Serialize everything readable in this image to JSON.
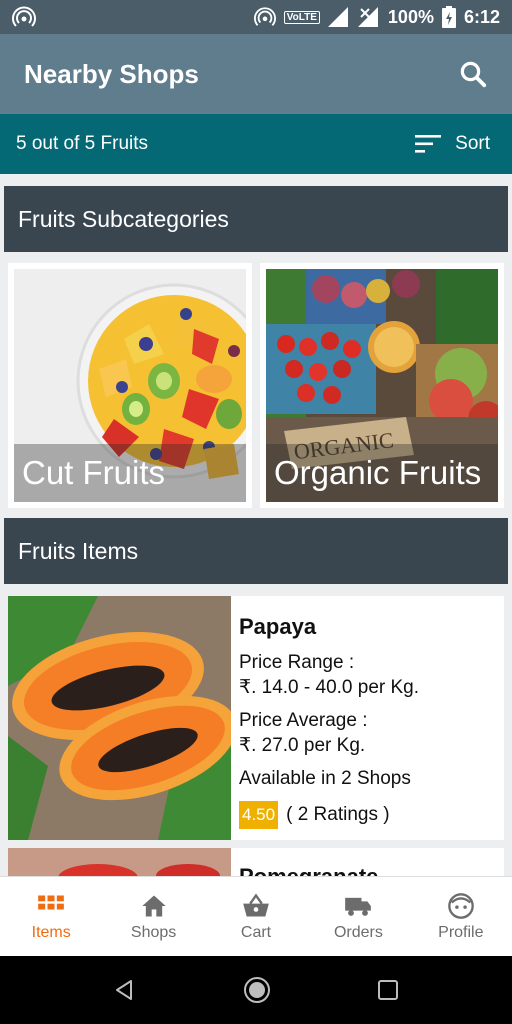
{
  "status_bar": {
    "battery": "100%",
    "time": "6:12",
    "network": "4G",
    "volte": "VoLTE"
  },
  "app_bar": {
    "title": "Nearby Shops"
  },
  "sub_bar": {
    "count_text": "5 out of 5 Fruits",
    "sort_label": "Sort"
  },
  "subcategories": {
    "header": "Fruits Subcategories",
    "items": [
      {
        "label": "Cut Fruits"
      },
      {
        "label": "Organic Fruits",
        "sign_text": "ORGANIC"
      }
    ]
  },
  "items_section": {
    "header": "Fruits Items",
    "cards": [
      {
        "name": "Papaya",
        "price_range_label": "Price Range :",
        "price_range": "₹. 14.0 - 40.0 per Kg.",
        "price_avg_label": "Price Average :",
        "price_avg": "₹. 27.0 per Kg.",
        "availability": "Available in 2 Shops",
        "rating": "4.50",
        "ratings_count": "( 2 Ratings )"
      },
      {
        "name": "Pomegranate"
      }
    ]
  },
  "bottom_nav": [
    {
      "label": "Items",
      "icon": "grid-icon",
      "active": true
    },
    {
      "label": "Shops",
      "icon": "home-icon"
    },
    {
      "label": "Cart",
      "icon": "basket-icon"
    },
    {
      "label": "Orders",
      "icon": "truck-icon"
    },
    {
      "label": "Profile",
      "icon": "face-icon"
    }
  ],
  "colors": {
    "status_bar": "#4a5d69",
    "app_bar": "#5f7d8d",
    "sub_bar": "#056875",
    "section_header": "#394650",
    "accent": "#ee6c12",
    "rating_badge": "#f0b000"
  }
}
